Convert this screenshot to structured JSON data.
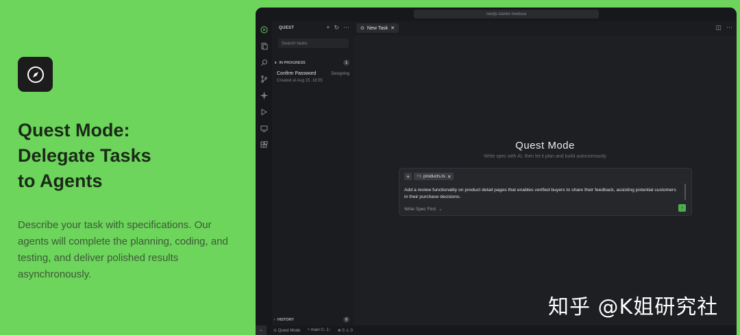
{
  "promo": {
    "headline_lines": [
      "Quest Mode:",
      "Delegate Tasks",
      "to Agents"
    ],
    "description": "Describe your task with specifications. Our agents will complete the planning, coding, and testing, and deliver polished results asynchronously."
  },
  "ide": {
    "project_name": "nextjs-starter-medusa",
    "activity_icons": [
      "quest-icon",
      "files-icon",
      "search-icon",
      "source-control-icon",
      "extensions-icon",
      "run-debug-icon",
      "remote-icon",
      "apps-icon"
    ],
    "panel": {
      "title": "QUEST",
      "search_placeholder": "Search tasks",
      "in_progress_label": "IN PROGRESS",
      "in_progress_count": "1",
      "tasks": [
        {
          "title": "Confirm Password",
          "state": "Designing",
          "created": "Created at Aug 15, 18:05"
        }
      ],
      "history_label": "HISTORY",
      "history_count": "0"
    },
    "tab": {
      "label": "New Task"
    },
    "editor": {
      "title": "Quest Mode",
      "subtitle": "Write spec with AI, then let it plan and build autonomously",
      "file_chip": {
        "ext": "TS",
        "name": "products.ts"
      },
      "prompt": "Add a review functionality on product detail pages that enables verified buyers to share their feedback, assisting potential customers in their purchase decisions.",
      "mode_label": "Write Spec First"
    },
    "status": {
      "mode": "Quest Mode",
      "branch": "main",
      "sync": "0↓ 1↑",
      "problems": "0 ⚠ 0"
    }
  },
  "watermark": "知乎 @K姐研究社",
  "colors": {
    "background": "#6dd45c",
    "ide_bg": "#1e1f22",
    "accent": "#4caf50"
  }
}
